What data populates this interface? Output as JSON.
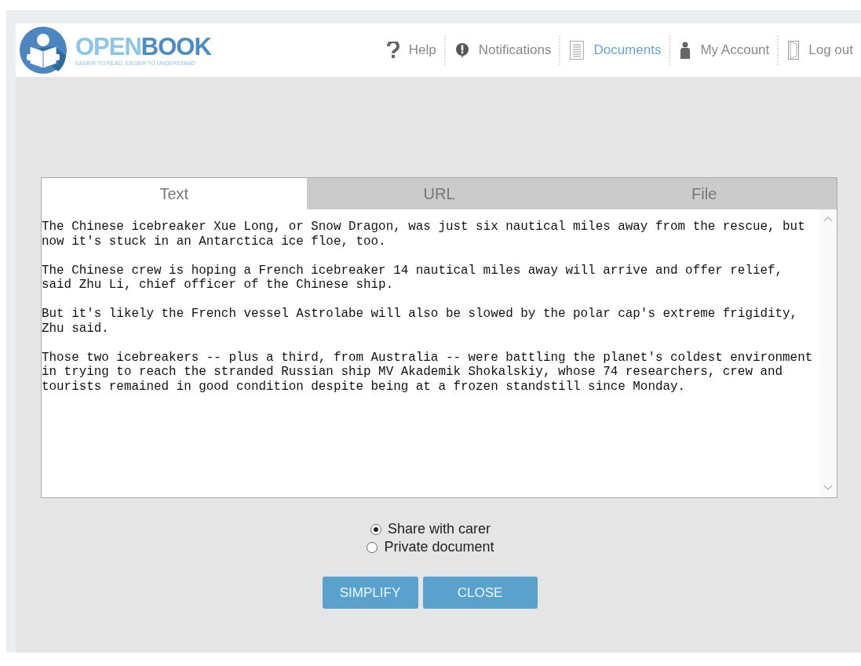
{
  "logo": {
    "name_light": "OPEN",
    "name_dark": "BOOK",
    "tagline": "EASIER TO READ, EASIER TO UNDERSTAND"
  },
  "nav": [
    {
      "kind": "help",
      "label": "Help",
      "selected": false
    },
    {
      "kind": "notifications",
      "label": "Notifications",
      "selected": false
    },
    {
      "kind": "documents",
      "label": "Documents",
      "selected": true
    },
    {
      "kind": "account",
      "label": "My Account",
      "selected": false
    },
    {
      "kind": "logout",
      "label": "Log out",
      "selected": false
    }
  ],
  "tabs": [
    {
      "label": "Text",
      "selected": true
    },
    {
      "label": "URL",
      "selected": false
    },
    {
      "label": "File",
      "selected": false
    }
  ],
  "text_input": {
    "paragraphs": [
      "The Chinese icebreaker Xue Long, or Snow Dragon, was just six nautical miles away from the rescue, but now it's stuck in an Antarctica ice floe, too.",
      "The Chinese crew is hoping a French icebreaker 14 nautical miles away will arrive and offer relief, said Zhu Li, chief officer of the Chinese ship.",
      "But it's likely the French vessel Astrolabe will also be slowed by the polar cap's extreme frigidity, Zhu said.",
      "Those two icebreakers -- plus a third, from Australia -- were battling the planet's coldest environment in trying to reach the stranded Russian ship MV Akademik Shokalskiy, whose 74 researchers, crew and tourists remained in good condition despite being at a frozen standstill since Monday."
    ]
  },
  "sharing": [
    {
      "label": "Share with carer",
      "selected": true
    },
    {
      "label": "Private document",
      "selected": false
    }
  ],
  "buttons": [
    "SIMPLIFY",
    "CLOSE"
  ]
}
